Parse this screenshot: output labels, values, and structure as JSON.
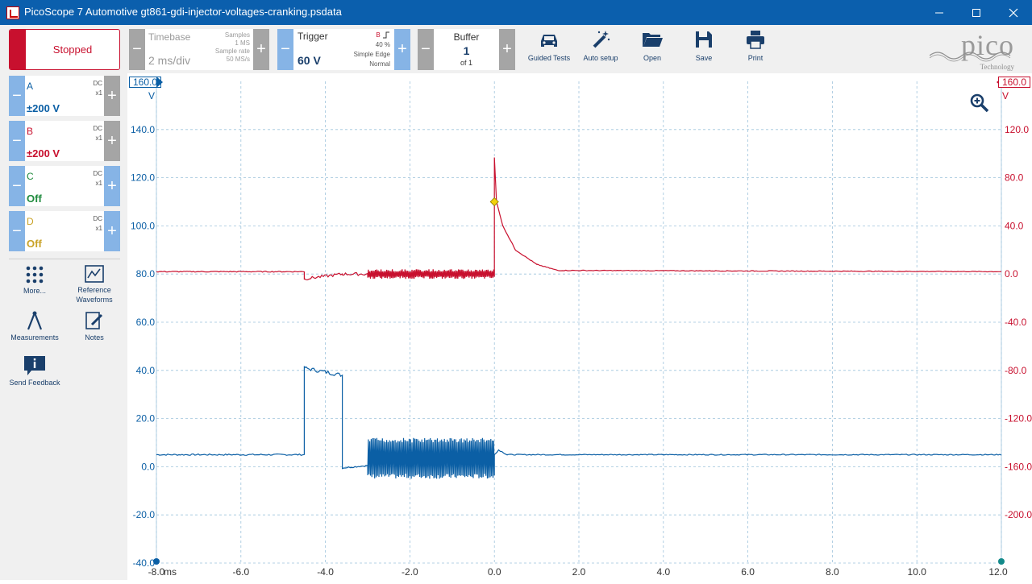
{
  "window": {
    "title": "PicoScope 7 Automotive gt861-gdi-injector-voltages-cranking.psdata",
    "minimize_icon": "minimize-icon",
    "maximize_icon": "maximize-icon",
    "close_icon": "close-icon"
  },
  "run": {
    "label": "Stopped"
  },
  "timebase": {
    "label": "Timebase",
    "value": "2 ms/div",
    "samples_label": "Samples",
    "samples": "1 MS",
    "rate_label": "Sample rate",
    "rate": "50 MS/s"
  },
  "trigger": {
    "label": "Trigger",
    "value": "60 V",
    "channel": "B",
    "position": "40 %",
    "type": "Simple Edge",
    "mode": "Normal"
  },
  "buffer": {
    "label": "Buffer",
    "value": "1",
    "of": "of 1"
  },
  "toolbar": {
    "guided_tests": "Guided Tests",
    "auto_setup": "Auto setup",
    "open": "Open",
    "save": "Save",
    "print": "Print"
  },
  "logo": {
    "text": "pico",
    "sub": "Technology"
  },
  "channels": [
    {
      "name": "A",
      "coupling": "DC",
      "probe": "x1",
      "range": "±200 V",
      "color": "#0b5fa5"
    },
    {
      "name": "B",
      "coupling": "DC",
      "probe": "x1",
      "range": "±200 V",
      "color": "#c8102e"
    },
    {
      "name": "C",
      "coupling": "DC",
      "probe": "x1",
      "range": "Off",
      "color": "#1e8a3c"
    },
    {
      "name": "D",
      "coupling": "DC",
      "probe": "x1",
      "range": "Off",
      "color": "#c9a227"
    }
  ],
  "sidebar": {
    "more": "More...",
    "reference": "Reference Waveforms",
    "measurements": "Measurements",
    "notes": "Notes",
    "feedback": "Send Feedback"
  },
  "colors": {
    "accent": "#0b5fad",
    "channel_a": "#0b5fa5",
    "channel_b": "#c8102e",
    "grid": "#9ec3dc"
  },
  "chart_data": {
    "type": "line",
    "title": "",
    "xlabel": "ms",
    "x_ticks": [
      "-8.0",
      "-6.0",
      "-4.0",
      "-2.0",
      "0.0",
      "2.0",
      "4.0",
      "6.0",
      "8.0",
      "10.0",
      "12.0"
    ],
    "xlim": [
      -8,
      12
    ],
    "ylabel_left": "V",
    "ylabel_right": "V",
    "left_ticks": [
      "140.0",
      "120.0",
      "100.0",
      "80.0",
      "60.0",
      "40.0",
      "20.0",
      "0.0",
      "-20.0",
      "-40.0"
    ],
    "right_ticks": [
      "120.0",
      "80.0",
      "40.0",
      "0.0",
      "-40.0",
      "-80.0",
      "-120.0",
      "-160.0",
      "-200.0"
    ],
    "left_top_badge": "160.0",
    "right_top_badge": "160.0",
    "ylim_left": [
      -40,
      160
    ],
    "ylim_right": [
      -240,
      160
    ],
    "grid": true,
    "series": [
      {
        "name": "A",
        "axis": "left",
        "segments": [
          {
            "x": [
              -8,
              -4.5
            ],
            "y": [
              5,
              5
            ],
            "noise": 0.3
          },
          {
            "x": [
              -4.5,
              -4.5,
              -3.6,
              -3.6
            ],
            "y": [
              5,
              41,
              38,
              -0.5
            ],
            "noise": 0.8
          },
          {
            "x": [
              -3.6,
              -3.0
            ],
            "y": [
              -0.5,
              0.5
            ],
            "noise": 0.3
          },
          {
            "x": [
              -3.0,
              0.0
            ],
            "y": [
              -5,
              12
            ],
            "burst": true
          },
          {
            "x": [
              0.0,
              0.1,
              0.3,
              12
            ],
            "y": [
              5,
              7,
              5,
              5
            ],
            "noise": 0.2
          }
        ]
      },
      {
        "name": "B",
        "axis": "right",
        "segments": [
          {
            "x": [
              -8,
              -4.5
            ],
            "y": [
              2,
              2
            ],
            "noise": 0.4
          },
          {
            "x": [
              -4.5,
              -4.5,
              -3.6,
              -3.0
            ],
            "y": [
              2,
              -4,
              0,
              0
            ],
            "noise": 1.2
          },
          {
            "x": [
              -3.0,
              0.0
            ],
            "y": [
              -4,
              4
            ],
            "burst": true
          },
          {
            "x": [
              0.0,
              0.0,
              0.05,
              0.2,
              0.5,
              1.0,
              1.5,
              12
            ],
            "y": [
              -2,
              97,
              60,
              40,
              20,
              8,
              3,
              2
            ],
            "noise": 0.3
          }
        ]
      }
    ],
    "trigger_point": {
      "x": 0.0,
      "y": 60,
      "axis": "right"
    }
  }
}
